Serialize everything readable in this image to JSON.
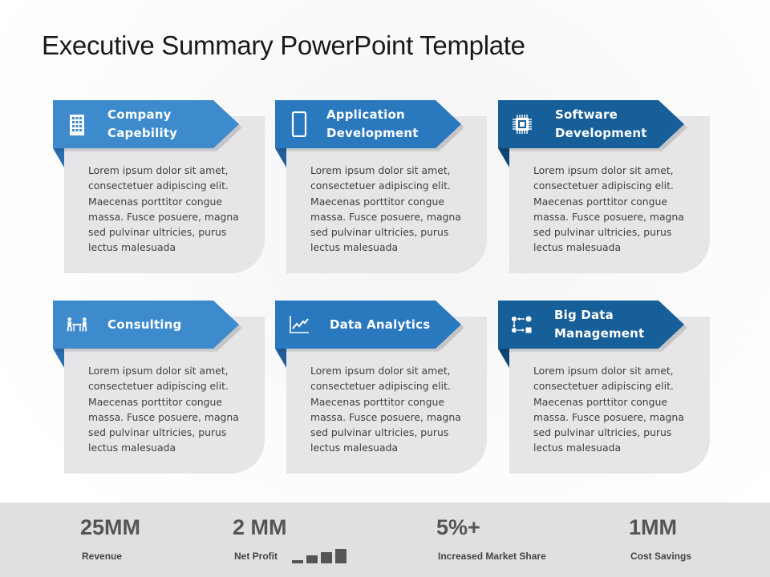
{
  "slide": {
    "title": "Executive Summary PowerPoint Template"
  },
  "colors": {
    "banner_light": "#3d8bcd",
    "banner_mid": "#2a78be",
    "banner_dark": "#175f98",
    "card_body": "#e6e6e8",
    "footer_bg": "#e0e0e0",
    "stat_text": "#555555"
  },
  "cards": [
    {
      "label": "Company\nCapebility",
      "icon": "building-icon",
      "text": "Lorem ipsum dolor sit amet,\nconsectetuer adipiscing elit.\nMaecenas porttitor congue\nmassa. Fusce posuere, magna\nsed pulvinar ultricies, purus\nlectus malesuada"
    },
    {
      "label": "Application\nDevelopment",
      "icon": "smartphone-icon",
      "text": "Lorem ipsum dolor sit amet,\nconsectetuer adipiscing elit.\nMaecenas porttitor congue\nmassa. Fusce posuere, magna\nsed pulvinar ultricies, purus\nlectus malesuada"
    },
    {
      "label": "Software\nDevelopment",
      "icon": "chip-icon",
      "text": "Lorem ipsum dolor sit amet,\nconsectetuer adipiscing elit.\nMaecenas porttitor congue\nmassa. Fusce posuere, magna\nsed pulvinar ultricies, purus\nlectus malesuada"
    },
    {
      "label": "Consulting",
      "icon": "meeting-icon",
      "text": "Lorem ipsum dolor sit amet,\nconsectetuer adipiscing elit.\nMaecenas porttitor congue\nmassa. Fusce posuere, magna\nsed pulvinar ultricies, purus\nlectus malesuada"
    },
    {
      "label": "Data Analytics",
      "icon": "line-chart-icon",
      "text": "Lorem ipsum dolor sit amet,\nconsectetuer adipiscing elit.\nMaecenas porttitor congue\nmassa. Fusce posuere, magna\nsed pulvinar ultricies, purus\nlectus malesuada"
    },
    {
      "label": "Big Data\nManagement",
      "icon": "data-flow-icon",
      "text": "Lorem ipsum dolor sit amet,\nconsectetuer adipiscing elit.\nMaecenas porttitor congue\nmassa. Fusce posuere, magna\nsed pulvinar ultricies, purus\nlectus malesuada"
    }
  ],
  "stats": [
    {
      "value": "25MM",
      "caption": "Revenue"
    },
    {
      "value": "2 MM",
      "caption": "Net Profit"
    },
    {
      "value": "5%+",
      "caption": "Increased Market Share"
    },
    {
      "value": "1MM",
      "caption": "Cost Savings"
    }
  ],
  "net_profit_bars": {
    "icon": "bar-growth-icon",
    "relative_heights": [
      0.2,
      0.55,
      0.75,
      1.0
    ]
  }
}
